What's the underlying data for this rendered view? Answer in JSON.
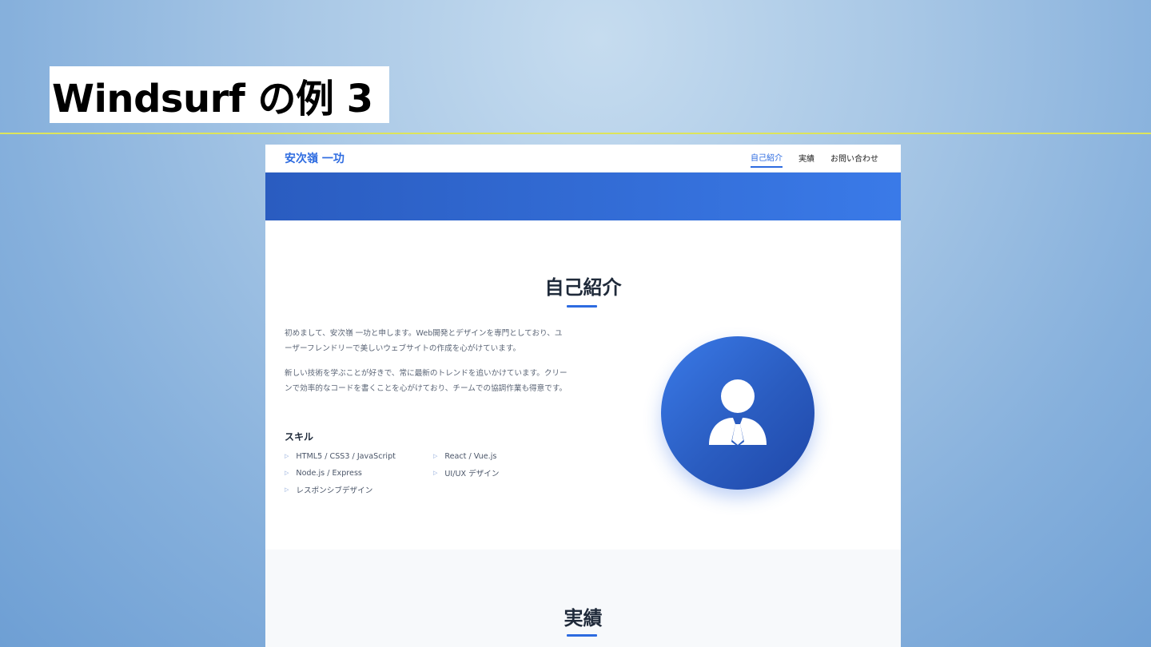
{
  "slide": {
    "title": "Windsurf の例 3"
  },
  "site": {
    "logo": "安次嶺 一功",
    "nav": [
      {
        "label": "自己紹介",
        "active": true
      },
      {
        "label": "実績",
        "active": false
      },
      {
        "label": "お問い合わせ",
        "active": false
      }
    ],
    "about": {
      "title": "自己紹介",
      "paragraphs": [
        "初めまして、安次嶺 一功と申します。Web開発とデザインを専門としており、ユーザーフレンドリーで美しいウェブサイトの作成を心がけています。",
        "新しい技術を学ぶことが好きで、常に最新のトレンドを追いかけています。クリーンで効率的なコードを書くことを心がけており、チームでの協調作業も得意です。"
      ],
      "skills_title": "スキル",
      "skills": [
        "HTML5 / CSS3 / JavaScript",
        "React / Vue.js",
        "Node.js / Express",
        "UI/UX デザイン",
        "レスポンシブデザイン"
      ],
      "avatar_icon": "user-businessman-icon"
    },
    "works": {
      "title": "実績"
    }
  },
  "colors": {
    "accent": "#2d6be0",
    "hero_start": "#2a5cc0",
    "hero_end": "#3a7ae8",
    "heading": "#1f2a3a"
  }
}
